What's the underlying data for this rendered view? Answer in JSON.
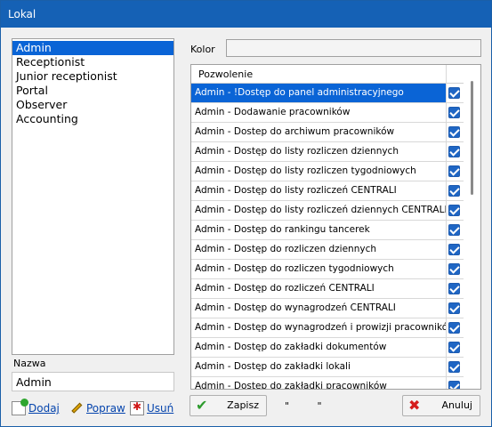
{
  "window": {
    "title": "Lokal"
  },
  "roles": {
    "items": [
      "Admin",
      "Receptionist",
      "Junior receptionist",
      "Portal",
      "Observer",
      "Accounting"
    ],
    "selected_index": 0
  },
  "nazwa": {
    "label": "Nazwa",
    "value": "Admin"
  },
  "links": {
    "add_label": "Dodaj",
    "edit_label": "Popraw",
    "delete_label": "Usuń"
  },
  "kolor": {
    "label": "Kolor",
    "value": ""
  },
  "permissions": {
    "header": "Pozwolenie",
    "rows": [
      {
        "label": "Admin - !Dostęp do panel administracyjnego",
        "checked": true
      },
      {
        "label": "Admin - Dodawanie pracowników",
        "checked": true
      },
      {
        "label": "Admin - Dostep do archiwum pracowników",
        "checked": true
      },
      {
        "label": "Admin - Dostęp do listy rozliczen dziennych",
        "checked": true
      },
      {
        "label": "Admin - Dostęp do listy rozliczen tygodniowych",
        "checked": true
      },
      {
        "label": "Admin - Dostęp do listy rozliczeń CENTRALI",
        "checked": true
      },
      {
        "label": "Admin - Dostęp do listy rozliczeń dziennych CENTRALI",
        "checked": true
      },
      {
        "label": "Admin - Dostęp do rankingu tancerek",
        "checked": true
      },
      {
        "label": "Admin - Dostęp do rozliczen dziennych",
        "checked": true
      },
      {
        "label": "Admin - Dostęp do rozliczen tygodniowych",
        "checked": true
      },
      {
        "label": "Admin - Dostęp do rozliczeń CENTRALI",
        "checked": true
      },
      {
        "label": "Admin - Dostęp do wynagrodzeń CENTRALI",
        "checked": true
      },
      {
        "label": "Admin - Dostęp do wynagrodzeń i prowizji pracowników",
        "checked": true
      },
      {
        "label": "Admin - Dostęp do zakładki dokumentów",
        "checked": true
      },
      {
        "label": "Admin - Dostęp do zakładki lokali",
        "checked": true
      },
      {
        "label": "Admin - Dostęp do zakładki pracowników",
        "checked": true
      }
    ],
    "selected_index": 0
  },
  "buttons": {
    "save_label": "Zapisz",
    "cancel_label": "Anuluj",
    "quote_text": "\" \""
  },
  "colors": {
    "titlebar": "#1561b5",
    "selection": "#0a64d6",
    "checkbox": "#1f66c4"
  }
}
